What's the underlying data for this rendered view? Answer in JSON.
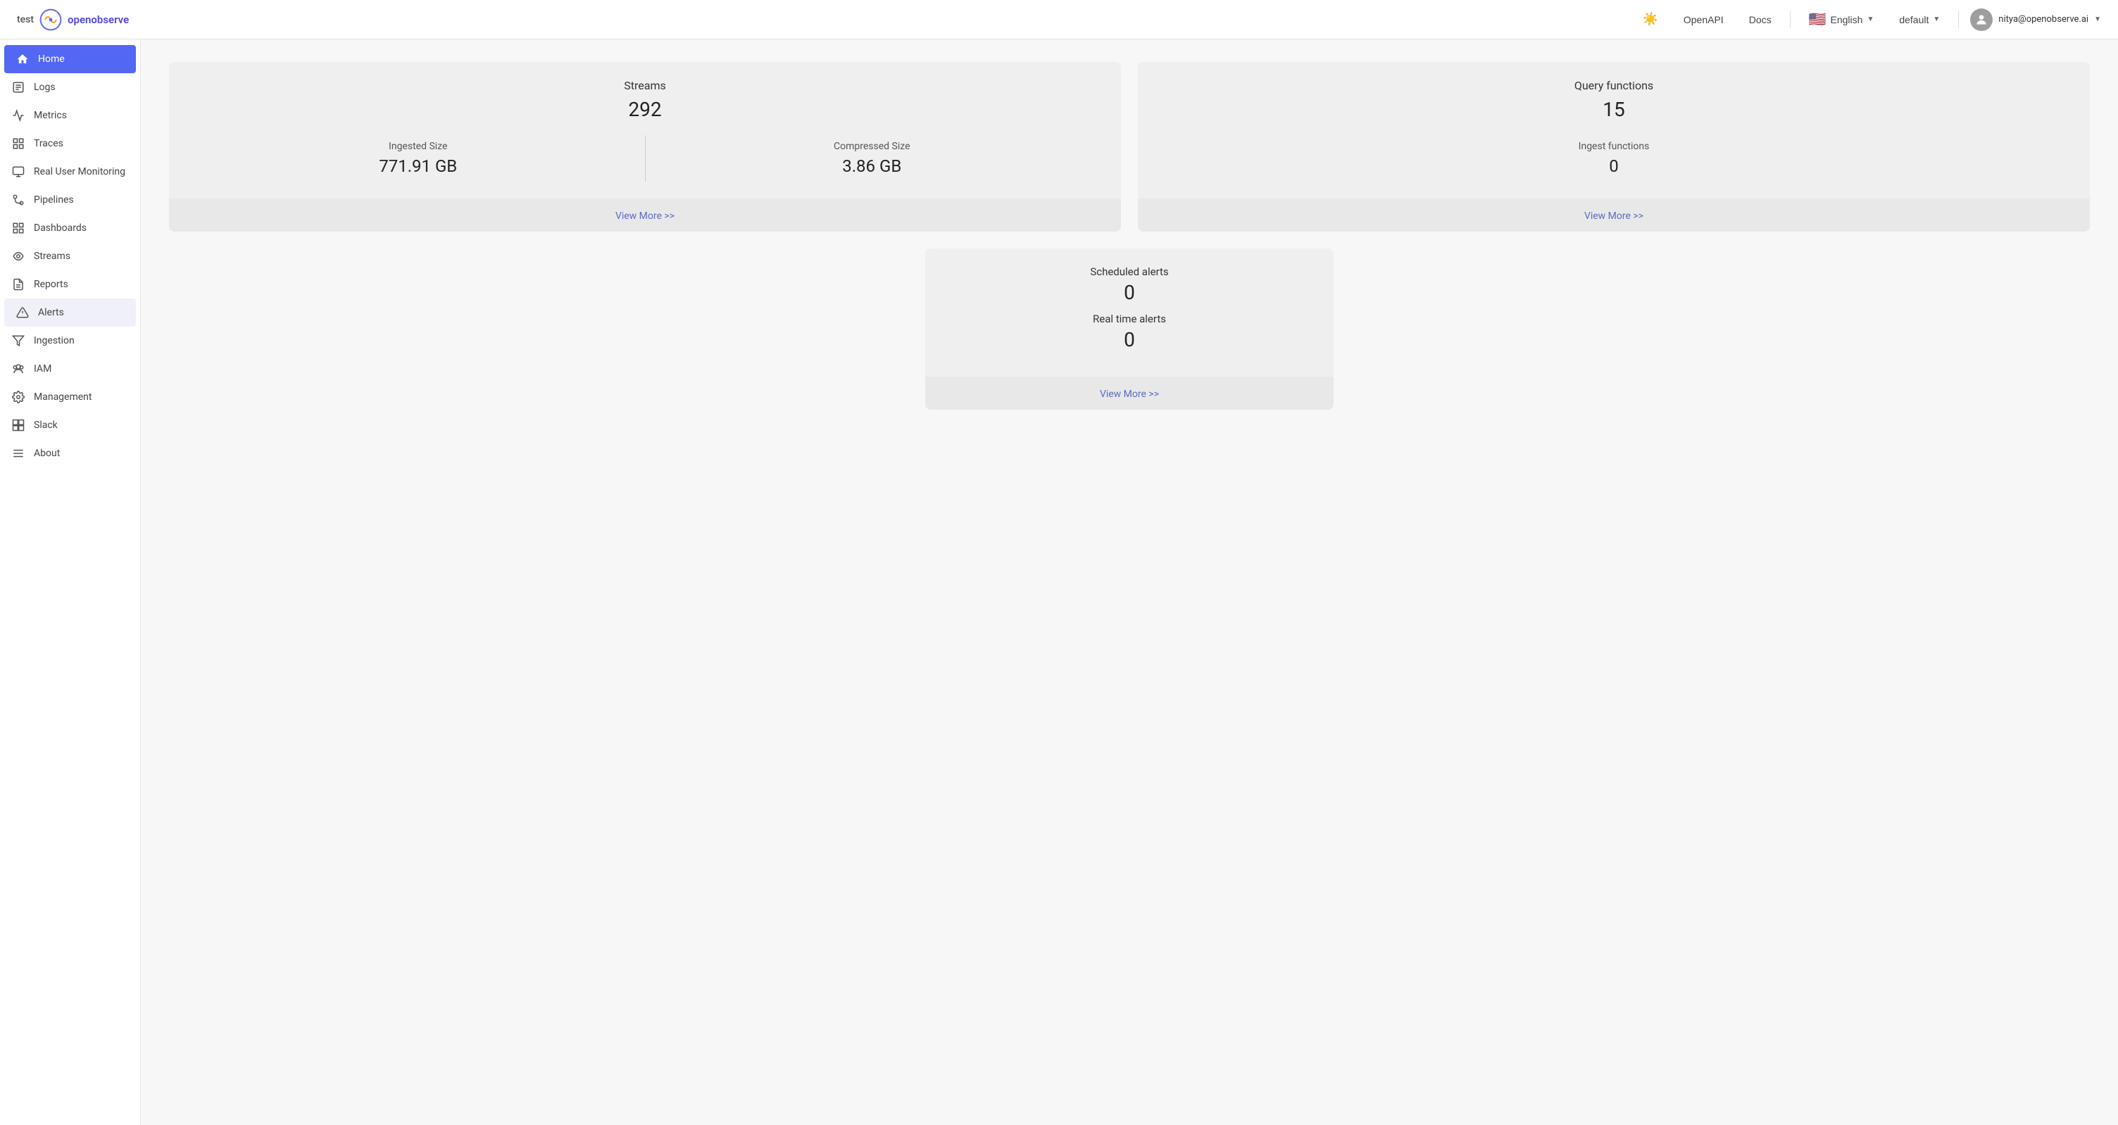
{
  "header": {
    "brand_test": "test",
    "logo_alt": "OpenObserve Logo",
    "theme_toggle_title": "Toggle Theme",
    "openapi_label": "OpenAPI",
    "docs_label": "Docs",
    "language_flag": "🇺🇸",
    "language_label": "English",
    "org_label": "default",
    "user_email": "nitya@openobserve.ai"
  },
  "sidebar": {
    "items": [
      {
        "id": "home",
        "label": "Home",
        "icon": "home",
        "active": true
      },
      {
        "id": "logs",
        "label": "Logs",
        "icon": "logs"
      },
      {
        "id": "metrics",
        "label": "Metrics",
        "icon": "metrics"
      },
      {
        "id": "traces",
        "label": "Traces",
        "icon": "traces"
      },
      {
        "id": "rum",
        "label": "Real User Monitoring",
        "icon": "rum"
      },
      {
        "id": "pipelines",
        "label": "Pipelines",
        "icon": "pipelines"
      },
      {
        "id": "dashboards",
        "label": "Dashboards",
        "icon": "dashboards"
      },
      {
        "id": "streams",
        "label": "Streams",
        "icon": "streams"
      },
      {
        "id": "reports",
        "label": "Reports",
        "icon": "reports"
      },
      {
        "id": "alerts",
        "label": "Alerts",
        "icon": "alerts",
        "highlighted": true
      },
      {
        "id": "ingestion",
        "label": "Ingestion",
        "icon": "ingestion"
      },
      {
        "id": "iam",
        "label": "IAM",
        "icon": "iam"
      },
      {
        "id": "management",
        "label": "Management",
        "icon": "management"
      },
      {
        "id": "slack",
        "label": "Slack",
        "icon": "slack"
      },
      {
        "id": "about",
        "label": "About",
        "icon": "about"
      }
    ]
  },
  "main": {
    "streams_card": {
      "title": "Streams",
      "count": "292",
      "ingested_size_label": "Ingested Size",
      "ingested_size_value": "771.91 GB",
      "compressed_size_label": "Compressed Size",
      "compressed_size_value": "3.86 GB",
      "view_more": "View More >>"
    },
    "query_card": {
      "title": "Query functions",
      "count": "15",
      "ingest_label": "Ingest functions",
      "ingest_value": "0",
      "view_more": "View More >>"
    },
    "alerts_card": {
      "title": "Scheduled alerts",
      "scheduled_value": "0",
      "realtime_label": "Real time alerts",
      "realtime_value": "0",
      "view_more": "View More >>"
    }
  }
}
